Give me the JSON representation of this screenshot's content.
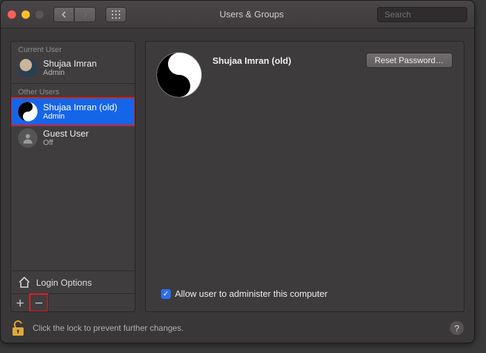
{
  "window": {
    "title": "Users & Groups"
  },
  "search": {
    "placeholder": "Search"
  },
  "sidebar": {
    "current_header": "Current User",
    "current": {
      "name": "Shujaa Imran",
      "role": "Admin"
    },
    "other_header": "Other Users",
    "others": [
      {
        "name": "Shujaa Imran (old)",
        "role": "Admin"
      },
      {
        "name": "Guest User",
        "role": "Off"
      }
    ],
    "login_options": "Login Options"
  },
  "main": {
    "name": "Shujaa Imran (old)",
    "reset_button": "Reset Password…",
    "admin_checkbox_label": "Allow user to administer this computer",
    "admin_checked": true
  },
  "footer": {
    "lock_text": "Click the lock to prevent further changes."
  }
}
